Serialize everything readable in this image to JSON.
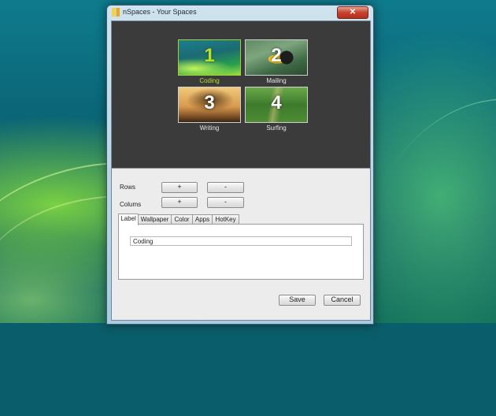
{
  "window": {
    "title": "nSpaces - Your Spaces",
    "close_glyph": "✕"
  },
  "spaces": [
    {
      "number": "1",
      "label": "Coding",
      "selected": true,
      "wallpaper": "aurora-green"
    },
    {
      "number": "2",
      "label": "Mailing",
      "selected": false,
      "wallpaper": "toucan"
    },
    {
      "number": "3",
      "label": "Writing",
      "selected": false,
      "wallpaper": "tree-sunset"
    },
    {
      "number": "4",
      "label": "Surfing",
      "selected": false,
      "wallpaper": "forest-path"
    }
  ],
  "grid_controls": {
    "rows_label": "Rows",
    "columns_label": "Colums",
    "add_label": "+",
    "remove_label": "-"
  },
  "tabs": [
    {
      "label": "Label",
      "active": true
    },
    {
      "label": "Wallpaper",
      "active": false
    },
    {
      "label": "Color",
      "active": false
    },
    {
      "label": "Apps",
      "active": false
    },
    {
      "label": "HotKey",
      "active": false
    }
  ],
  "label_tab": {
    "value": "Coding"
  },
  "footer": {
    "save_label": "Save",
    "cancel_label": "Cancel"
  },
  "colors": {
    "selected_accent": "#b7e02a",
    "preview_background": "#3b3b3b"
  }
}
